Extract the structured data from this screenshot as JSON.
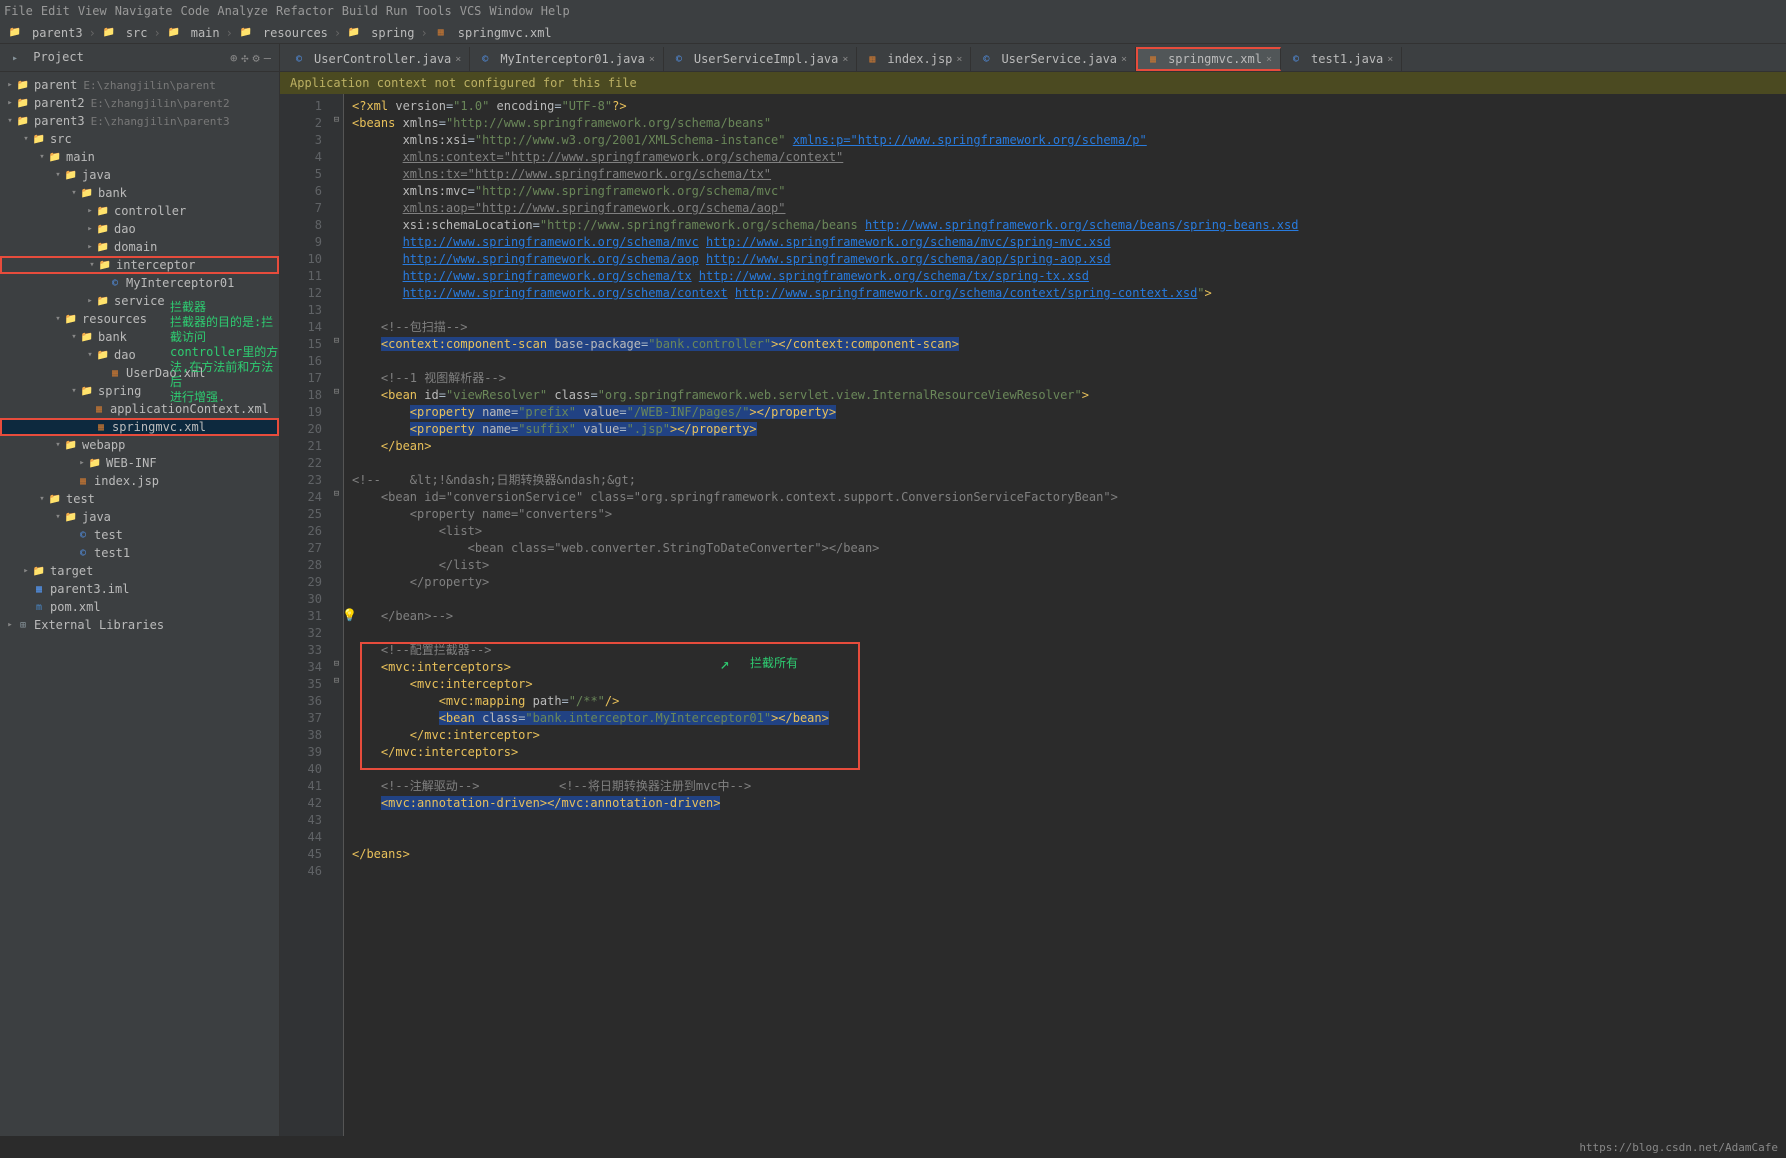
{
  "menu": [
    "File",
    "Edit",
    "View",
    "Navigate",
    "Code",
    "Analyze",
    "Refactor",
    "Build",
    "Run",
    "Tools",
    "VCS",
    "Window",
    "Help"
  ],
  "breadcrumb": [
    "parent3",
    "src",
    "main",
    "resources",
    "spring",
    "springmvc.xml"
  ],
  "sidebar_title": "Project",
  "tree": {
    "parent": {
      "label": "parent",
      "path": "E:\\zhangjilin\\parent"
    },
    "parent2": {
      "label": "parent2",
      "path": "E:\\zhangjilin\\parent2"
    },
    "parent3": {
      "label": "parent3",
      "path": "E:\\zhangjilin\\parent3"
    },
    "src": "src",
    "main": "main",
    "java": "java",
    "bank": "bank",
    "controller": "controller",
    "dao": "dao",
    "domain": "domain",
    "interceptor": "interceptor",
    "myinterceptor": "MyInterceptor01",
    "service": "service",
    "resources": "resources",
    "bank2": "bank",
    "dao2": "dao",
    "userdao": "UserDao.xml",
    "spring": "spring",
    "appctx": "applicationContext.xml",
    "springmvc": "springmvc.xml",
    "webapp": "webapp",
    "webinf": "WEB-INF",
    "indexjsp": "index.jsp",
    "test": "test",
    "java2": "java",
    "testc": "test",
    "test1": "test1",
    "target": "target",
    "parent3iml": "parent3.iml",
    "pom": "pom.xml",
    "extlib": "External Libraries"
  },
  "annotation_sidebar": "拦截器\n拦截器的目的是:拦截访问\ncontroller里的方法,在方法前和方法后\n进行增强.",
  "tabs": [
    {
      "label": "UserController.java",
      "icon": "c"
    },
    {
      "label": "MyInterceptor01.java",
      "icon": "c"
    },
    {
      "label": "UserServiceImpl.java",
      "icon": "c"
    },
    {
      "label": "index.jsp",
      "icon": "x"
    },
    {
      "label": "UserService.java",
      "icon": "c"
    },
    {
      "label": "springmvc.xml",
      "icon": "x",
      "active": true
    },
    {
      "label": "test1.java",
      "icon": "c"
    }
  ],
  "banner": "Application context not configured for this file",
  "annotation_code": "拦截所有",
  "watermark": "https://blog.csdn.net/AdamCafe",
  "line_count": 46
}
